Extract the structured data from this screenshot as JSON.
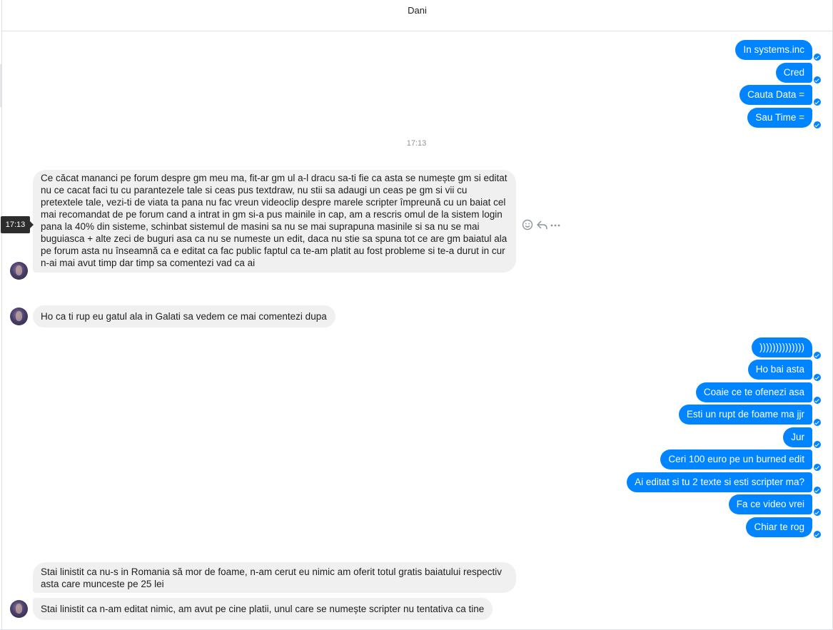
{
  "header": {
    "title": "Dani"
  },
  "thread": {
    "sent_group_1": [
      "In systems.inc",
      "Cred",
      "Cauta Data =",
      "Sau Time ="
    ],
    "divider_time": "17:13",
    "hover_tooltip": "17:13",
    "received_1": "Ce căcat mananci pe forum despre gm meu ma, fit-ar gm ul a-l dracu sa-ti fie ca asta se numește gm si editat nu ce cacat faci tu cu parantezele tale si ceas pus textdraw, nu stii sa adaugi un ceas pe gm si vii cu pretextele tale, vezi-ti de viata ta pana nu fac vreun videoclip despre marele scripter împreună cu un baiat cel mai recomandat de pe forum cand a intrat in gm si-a pus mainile in cap, am a rescris omul de la sistem login pana la 40% din sisteme, schinbat sistemul de masini sa nu se mai suprapuna masinile si sa nu se mai buguiasca + alte zeci de buguri asa ca nu se numeste un edit, daca nu stie sa spuna tot ce are gm baiatul ala pe forum asta nu înseamnă ca e editat ca fac public faptul ca te-am platit au fost probleme si te-a durut in cur n-ai mai avut timp dar timp sa comentezi vad ca ai",
    "received_2": "Ho ca ti rup eu gatul ala in Galati sa vedem ce mai comentezi dupa",
    "sent_group_2": [
      "))))))))))))))",
      "Ho bai asta",
      "Coaie ce te ofenezi asa",
      "Esti un rupt de foame ma jjr",
      "Jur",
      "Ceri 100 euro pe un burned edit",
      "Ai editat si tu 2 texte si esti scripter ma?",
      "Fa ce video vrei",
      "Chiar te rog"
    ],
    "received_3": "Stai linistit ca nu-s in Romania să mor de foame, n-am cerut eu nimic am oferit totul gratis baiatului respectiv asta care munceste pe 25 lei",
    "received_4": "Stai linistit ca n-am editat nimic, am avut pe cine platii, unul care se numește scripter nu tentativa ca tine"
  },
  "icons": [
    "emoji-icon",
    "reply-icon",
    "more-icon",
    "seen-check-icon",
    "avatar"
  ],
  "colors": {
    "sent_bubble": "#0084ff",
    "received_bubble": "#f1f0f0",
    "meta_text": "#90949c"
  }
}
